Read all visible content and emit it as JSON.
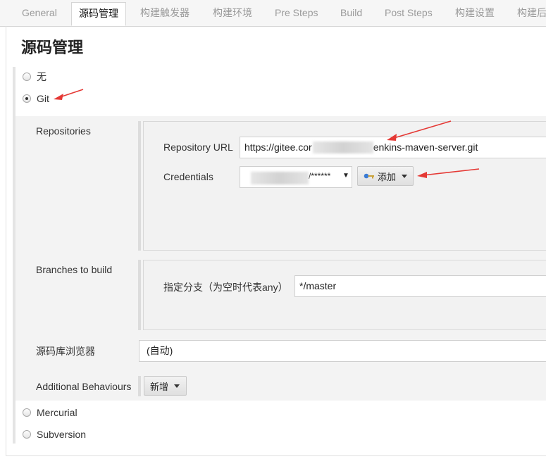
{
  "tabs": [
    {
      "label": "General"
    },
    {
      "label": "源码管理"
    },
    {
      "label": "构建触发器"
    },
    {
      "label": "构建环境"
    },
    {
      "label": "Pre Steps"
    },
    {
      "label": "Build"
    },
    {
      "label": "Post Steps"
    },
    {
      "label": "构建设置"
    },
    {
      "label": "构建后"
    }
  ],
  "page_title": "源码管理",
  "scm_options": {
    "none": "无",
    "git": "Git",
    "mercurial": "Mercurial",
    "subversion": "Subversion"
  },
  "git": {
    "repositories_label": "Repositories",
    "repo_url_label": "Repository URL",
    "repo_url_prefix": "https://gitee.cor",
    "repo_url_suffix": "enkins-maven-server.git",
    "credentials_label": "Credentials",
    "credentials_value": "/******",
    "add_button": "添加",
    "branches_label": "Branches to build",
    "branch_field_label": "指定分支（为空时代表any）",
    "branch_value": "*/master",
    "browser_label": "源码库浏览器",
    "browser_value": "(自动)",
    "behaviours_label": "Additional Behaviours",
    "new_button": "新增"
  },
  "colors": {
    "annotation_arrow": "#e53935",
    "key_icon": "#3a7bd5"
  }
}
